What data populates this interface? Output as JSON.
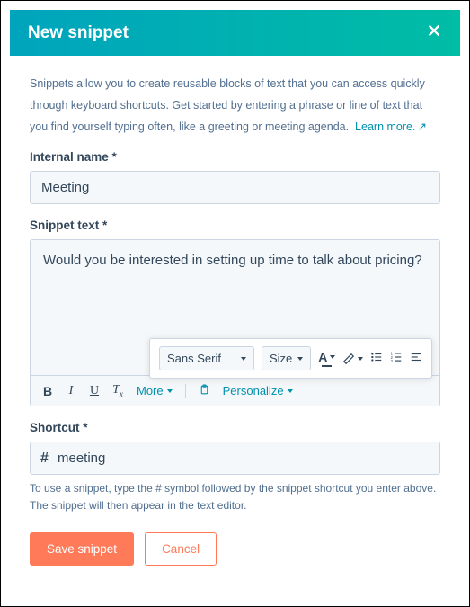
{
  "header": {
    "title": "New snippet"
  },
  "description": {
    "text": "Snippets allow you to create reusable blocks of text that you can access quickly through keyboard shortcuts. Get started by entering a phrase or line of text that you find yourself typing often, like a greeting or meeting agenda.",
    "learn_more": "Learn more."
  },
  "fields": {
    "internal_name_label": "Internal name *",
    "internal_name_value": "Meeting",
    "snippet_text_label": "Snippet text *",
    "snippet_text_value": "Would you be interested in setting up time to talk about pricing?",
    "shortcut_label": "Shortcut *",
    "shortcut_prefix": "#",
    "shortcut_value": "meeting",
    "shortcut_help": "To use a snippet, type the # symbol followed by the snippet shortcut you enter above. The snippet will then appear in the text editor."
  },
  "toolbar": {
    "more": "More",
    "personalize": "Personalize"
  },
  "popover": {
    "font_family": "Sans Serif",
    "size": "Size",
    "text_color_glyph": "A"
  },
  "buttons": {
    "save": "Save snippet",
    "cancel": "Cancel"
  }
}
